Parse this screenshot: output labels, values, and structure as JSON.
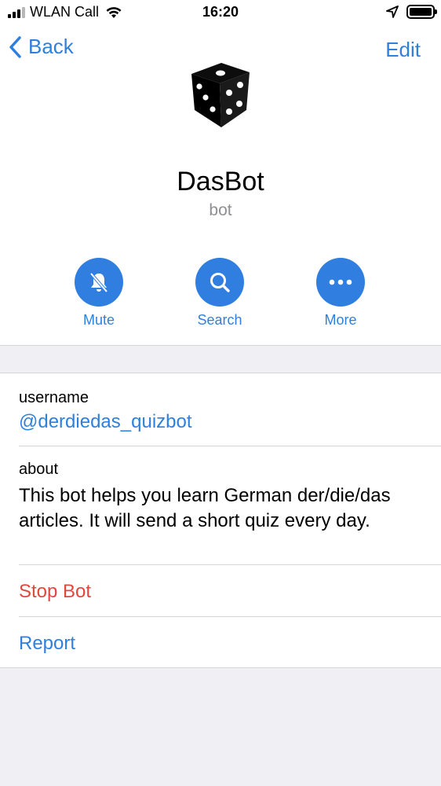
{
  "status_bar": {
    "carrier": "WLAN Call",
    "time": "16:20",
    "icons": [
      "signal-bars-icon",
      "wifi-icon",
      "location-arrow-icon",
      "battery-icon"
    ]
  },
  "nav": {
    "back_label": "Back",
    "edit_label": "Edit"
  },
  "profile": {
    "avatar_icon": "dice-icon",
    "name": "DasBot",
    "subtitle": "bot"
  },
  "actions": [
    {
      "label": "Mute",
      "icon": "bell-slash-icon"
    },
    {
      "label": "Search",
      "icon": "search-icon"
    },
    {
      "label": "More",
      "icon": "more-dots-icon"
    }
  ],
  "info": {
    "username_label": "username",
    "username_value": "@derdiedas_quizbot",
    "about_label": "about",
    "about_line1": "This bot helps you learn German der/die/das",
    "about_line2": "articles. It will send a short quiz every day."
  },
  "commands": {
    "stop_bot": "Stop Bot",
    "report": "Report"
  },
  "colors": {
    "accent": "#2f80dd",
    "destructive": "#e0483e",
    "background": "#efeff4",
    "secondary_text": "#8e8e93"
  }
}
